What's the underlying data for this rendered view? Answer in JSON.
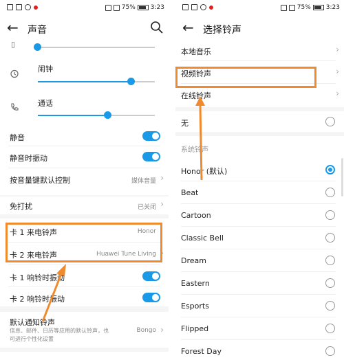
{
  "status_bar": {
    "battery": "75%",
    "time": "3:23"
  },
  "left": {
    "title": "声音",
    "alarm_label": "闹钟",
    "call_label": "通话",
    "mute_label": "静音",
    "vibrate_mute_label": "静音时振动",
    "volume_key_label": "按音量键默认控制",
    "volume_key_value": "媒体音量",
    "dnd_label": "免打扰",
    "dnd_value": "已关闭",
    "card1_ringtone_label": "卡 1 来电铃声",
    "card1_ringtone_value": "Honor",
    "card2_ringtone_label": "卡 2 来电铃声",
    "card2_ringtone_value": "Huawei Tune Living",
    "card1_vibrate_label": "卡 1 响铃时振动",
    "card2_vibrate_label": "卡 2 响铃时振动",
    "notify_label": "默认通知铃声",
    "notify_desc": "信息、邮件、日历等应用的默认铃声，也可进行个性化设置",
    "notify_value": "Bongo",
    "slider_levels": {
      "top": 0.0,
      "alarm": 0.8,
      "call": 0.6
    }
  },
  "right": {
    "title": "选择铃声",
    "local_music": "本地音乐",
    "video_ringtone": "视频铃声",
    "online_ringtone": "在线铃声",
    "none": "无",
    "system_header": "系统铃声",
    "ringtones": [
      "Honor (默认)",
      "Beat",
      "Cartoon",
      "Classic Bell",
      "Dream",
      "Eastern",
      "Esports",
      "Flipped",
      "Forest Day"
    ],
    "selected_index": 0
  },
  "colors": {
    "accent": "#1a9ae6",
    "highlight": "#f08a2e"
  }
}
